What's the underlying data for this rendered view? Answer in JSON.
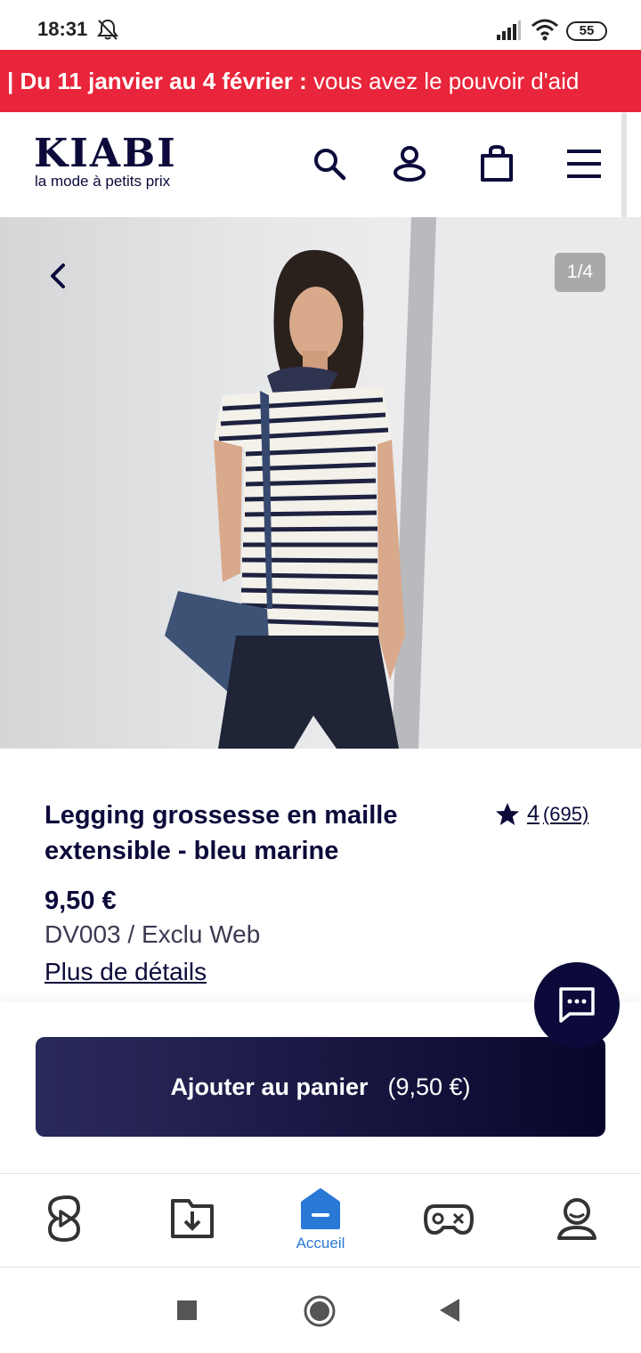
{
  "status_bar": {
    "time": "18:31",
    "battery": "55"
  },
  "promo": {
    "bold": "| Du 11 janvier au 4 février :",
    "text": " vous avez le pouvoir d'aid"
  },
  "header": {
    "logo": "KIABI",
    "tagline": "la mode à petits prix"
  },
  "gallery": {
    "counter": "1/4"
  },
  "product": {
    "title": "Legging grossesse en maille extensible - bleu marine",
    "rating_score": "4",
    "rating_count": "(695)",
    "price": "9,50 €",
    "reference": "DV003 / Exclu Web",
    "details_link": "Plus de détails"
  },
  "cart": {
    "label": "Ajouter au panier",
    "price": "(9,50 €)"
  },
  "app_nav": {
    "home_label": "Accueil",
    "active_color": "#2a78d6"
  },
  "colors": {
    "brand_navy": "#0b0a3a",
    "promo_red": "#e8253a"
  }
}
